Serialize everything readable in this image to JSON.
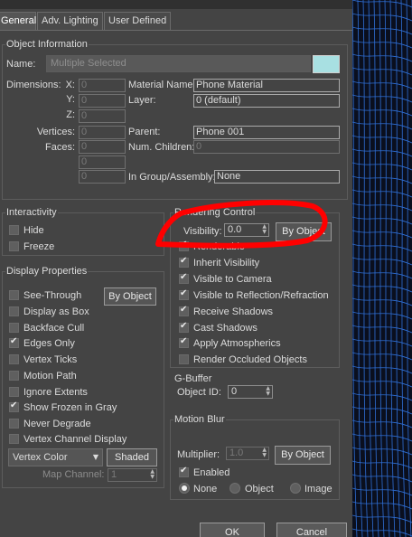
{
  "tabs": [
    "General",
    "Adv. Lighting",
    "User Defined"
  ],
  "object_information": {
    "title": "Object Information",
    "name_label": "Name:",
    "name_value": "Multiple Selected",
    "swatch_color": "#a8e0e2",
    "dimensions_label": "Dimensions:",
    "x_label": "X:",
    "x_value": "0",
    "y_label": "Y:",
    "y_value": "0",
    "z_label": "Z:",
    "z_value": "0",
    "vertices_label": "Vertices:",
    "vertices_value": "0",
    "faces_label": "Faces:",
    "faces_value": "0",
    "extra_value_1": "0",
    "extra_value_2": "0",
    "material_label": "Material Name:",
    "material_value": "Phone Material",
    "layer_label": "Layer:",
    "layer_value": "0 (default)",
    "parent_label": "Parent:",
    "parent_value": "Phone 001",
    "children_label": "Num. Children:",
    "children_value": "0",
    "group_label": "In Group/Assembly:",
    "group_value": "None"
  },
  "interactivity": {
    "title": "Interactivity",
    "items": [
      {
        "label": "Hide",
        "checked": false
      },
      {
        "label": "Freeze",
        "checked": false
      }
    ]
  },
  "display_properties": {
    "title": "Display Properties",
    "by_object_label": "By Object",
    "items": [
      {
        "label": "See-Through",
        "checked": false
      },
      {
        "label": "Display as Box",
        "checked": false
      },
      {
        "label": "Backface Cull",
        "checked": false
      },
      {
        "label": "Edges Only",
        "checked": true
      },
      {
        "label": "Vertex Ticks",
        "checked": false
      },
      {
        "label": "Motion Path",
        "checked": false
      },
      {
        "label": "Ignore Extents",
        "checked": false
      },
      {
        "label": "Show Frozen in Gray",
        "checked": true
      },
      {
        "label": "Never Degrade",
        "checked": false
      },
      {
        "label": "Vertex Channel Display",
        "checked": false
      }
    ],
    "vertex_color_label": "Vertex Color",
    "shaded_label": "Shaded",
    "map_channel_label": "Map Channel:",
    "map_channel_value": "1"
  },
  "rendering_control": {
    "title": "Rendering Control",
    "visibility_label": "Visibility:",
    "visibility_value": "0.0",
    "by_object_label": "By Object",
    "renderable_label": "Renderable",
    "items": [
      {
        "label": "Inherit Visibility",
        "checked": true
      },
      {
        "label": "Visible to Camera",
        "checked": true
      },
      {
        "label": "Visible to Reflection/Refraction",
        "checked": true
      },
      {
        "label": "Receive Shadows",
        "checked": true
      },
      {
        "label": "Cast Shadows",
        "checked": true
      },
      {
        "label": "Apply Atmospherics",
        "checked": true
      },
      {
        "label": "Render Occluded Objects",
        "checked": false
      }
    ]
  },
  "gbuffer": {
    "title": "G-Buffer",
    "object_id_label": "Object ID:",
    "object_id_value": "0"
  },
  "motion_blur": {
    "title": "Motion Blur",
    "multiplier_label": "Multiplier:",
    "multiplier_value": "1.0",
    "by_object_label": "By Object",
    "enabled_label": "Enabled",
    "enabled_checked": true,
    "radios": [
      {
        "label": "None",
        "selected": true
      },
      {
        "label": "Object",
        "selected": false
      },
      {
        "label": "Image",
        "selected": false
      }
    ]
  },
  "footer": {
    "ok_label": "OK",
    "cancel_label": "Cancel"
  },
  "colors": {
    "annotation_red": "#ff0000",
    "wireframe_blue": "#2f6fd6"
  }
}
